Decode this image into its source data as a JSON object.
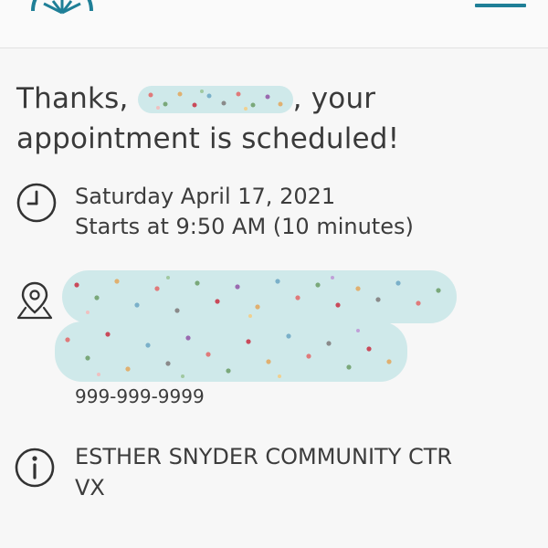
{
  "header": {
    "logo_icon": "sunburst-logo-icon",
    "menu_icon": "hamburger-menu-icon",
    "accent_color": "#1f7f97"
  },
  "confirmation": {
    "greeting_prefix": "Thanks, ",
    "greeting_suffix": ", your",
    "headline_line2": "appointment is scheduled!"
  },
  "appointment": {
    "date": "Saturday April 17, 2021",
    "time": "Starts at 9:50 AM (10 minutes)",
    "date_icon": "clock-icon"
  },
  "location": {
    "icon": "map-pin-icon",
    "phone": "999-999-9999"
  },
  "info": {
    "icon": "info-icon",
    "line1": "ESTHER SNYDER COMMUNITY CTR",
    "line2": "VX"
  }
}
